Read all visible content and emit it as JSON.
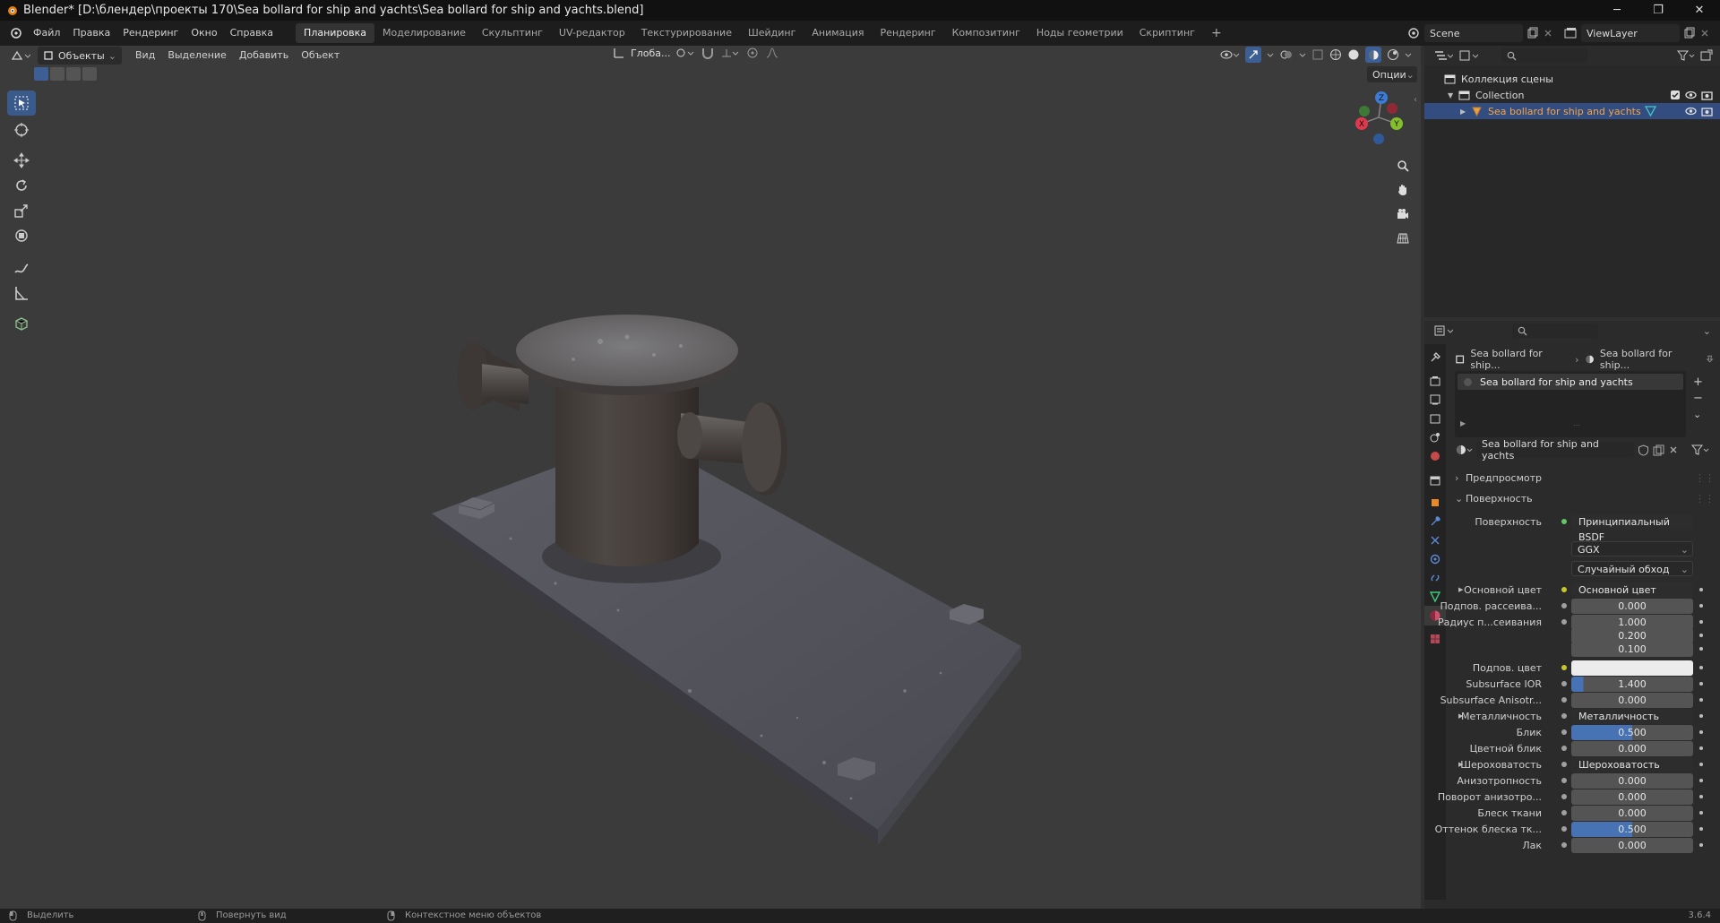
{
  "window": {
    "title": "Blender* [D:\\блендер\\проекты 170\\Sea bollard for ship and yachts\\Sea bollard for ship and yachts.blend]"
  },
  "menu": [
    "Файл",
    "Правка",
    "Рендеринг",
    "Окно",
    "Справка"
  ],
  "workspaces": [
    "Планировка",
    "Моделирование",
    "Скульптинг",
    "UV-редактор",
    "Текстурирование",
    "Шейдинг",
    "Анимация",
    "Рендеринг",
    "Композитинг",
    "Ноды геометрии",
    "Скриптинг"
  ],
  "active_workspace": "Планировка",
  "scene_name": "Scene",
  "view_layer": "ViewLayer",
  "viewport": {
    "mode": "Объекты",
    "menus": [
      "Вид",
      "Выделение",
      "Добавить",
      "Объект"
    ],
    "orientation": "Глоба...",
    "options_label": "Опции",
    "gizmo_axes": [
      "Z",
      "Y",
      "X"
    ]
  },
  "outliner": {
    "root": "Коллекция сцены",
    "collection": "Collection",
    "object": "Sea bollard for ship and yachts"
  },
  "properties": {
    "breadcrumb": [
      "Sea bollard for ship...",
      "Sea bollard for ship..."
    ],
    "material_slot": "Sea bollard for ship and yachts",
    "material_name": "Sea bollard for ship and yachts",
    "sections": {
      "preview": "Предпросмотр",
      "surface": "Поверхность"
    },
    "surface_label": "Поверхность",
    "surface_value": "Принципиальный BSDF",
    "distribution": "GGX",
    "subsurface_method": "Случайный обход",
    "rows": [
      {
        "label": "Основной цвет",
        "value": "Основной цвет",
        "kind": "link",
        "expand": true
      },
      {
        "label": "Подпов. рассеива...",
        "value": "0.000",
        "kind": "num"
      },
      {
        "label": "Радиус п...сеивания",
        "value": "1.000",
        "kind": "num"
      },
      {
        "label": "",
        "value": "0.200",
        "kind": "num"
      },
      {
        "label": "",
        "value": "0.100",
        "kind": "num"
      },
      {
        "label": "Подпов. цвет",
        "value": "",
        "kind": "color"
      },
      {
        "label": "Subsurface IOR",
        "value": "1.400",
        "kind": "num",
        "fill": 0.1
      },
      {
        "label": "Subsurface Anisotr...",
        "value": "0.000",
        "kind": "num"
      },
      {
        "label": "Металличность",
        "value": "Металличность",
        "kind": "link",
        "expand": true
      },
      {
        "label": "Блик",
        "value": "0.500",
        "kind": "num",
        "fill": 0.5
      },
      {
        "label": "Цветной блик",
        "value": "0.000",
        "kind": "num"
      },
      {
        "label": "Шероховатость",
        "value": "Шероховатость",
        "kind": "link",
        "expand": true
      },
      {
        "label": "Анизотропность",
        "value": "0.000",
        "kind": "num"
      },
      {
        "label": "Поворот анизотро...",
        "value": "0.000",
        "kind": "num"
      },
      {
        "label": "Блеск ткани",
        "value": "0.000",
        "kind": "num"
      },
      {
        "label": "Оттенок блеска тк...",
        "value": "0.500",
        "kind": "num",
        "fill": 0.5
      },
      {
        "label": "Лак",
        "value": "0.000",
        "kind": "num"
      }
    ]
  },
  "status": {
    "select": "Выделить",
    "rotate": "Повернуть вид",
    "context": "Контекстное меню объектов",
    "version": "3.6.4"
  }
}
